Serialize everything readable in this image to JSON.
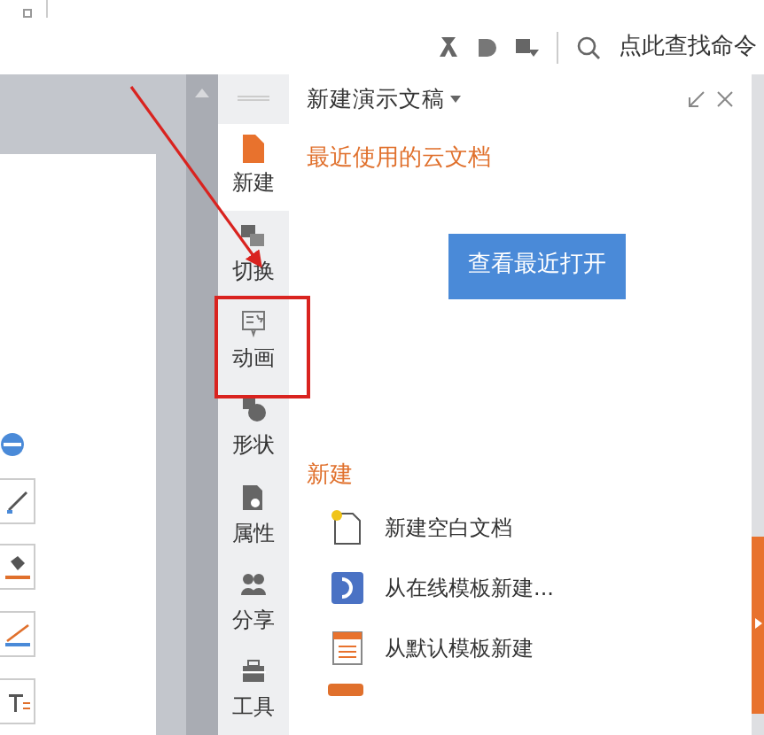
{
  "toolbar": {
    "search": {
      "placeholder": "点此查找命令"
    }
  },
  "side_tabs": [
    {
      "label": "新建",
      "kind": "new",
      "selected": true
    },
    {
      "label": "切换",
      "kind": "switch",
      "selected": false
    },
    {
      "label": "动画",
      "kind": "animation",
      "selected": false
    },
    {
      "label": "形状",
      "kind": "shape",
      "selected": false
    },
    {
      "label": "属性",
      "kind": "property",
      "selected": false
    },
    {
      "label": "分享",
      "kind": "share",
      "selected": false
    },
    {
      "label": "工具",
      "kind": "tools",
      "selected": false
    }
  ],
  "panel": {
    "title": "新建演示文稿",
    "cloud_heading": "最近使用的云文档",
    "recent_button": "查看最近打开",
    "new_heading": "新建",
    "new_items": [
      {
        "label": "新建空白文档",
        "kind": "blank"
      },
      {
        "label": "从在线模板新建...",
        "kind": "online"
      },
      {
        "label": "从默认模板新建",
        "kind": "default"
      }
    ]
  }
}
